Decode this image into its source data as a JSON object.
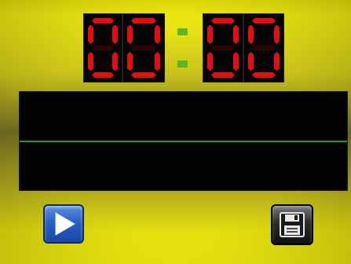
{
  "timer": {
    "minutes": "00",
    "seconds": "00",
    "digit_color": "#e01010",
    "digit_off_color": "#2a0505",
    "colon_color": "#5fb52a"
  },
  "scope": {
    "background": "#030303",
    "trace_color": "#1d9a4a"
  },
  "controls": {
    "play_icon": "play-icon",
    "save_icon": "floppy-disk-icon"
  }
}
